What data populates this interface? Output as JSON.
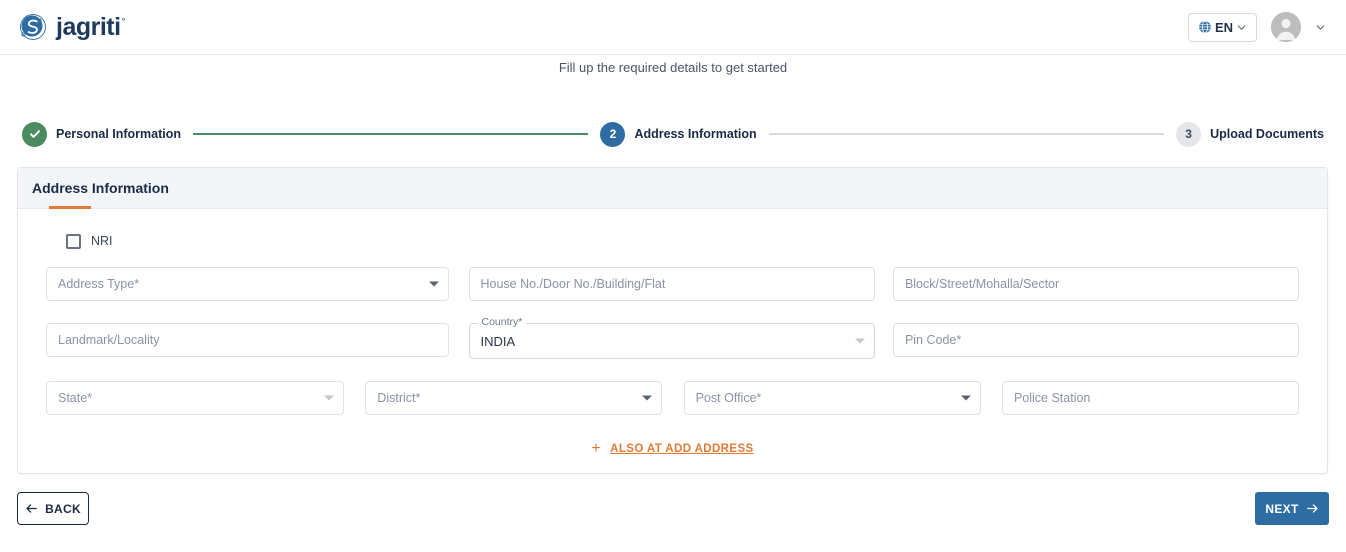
{
  "header": {
    "brand_name": "jagriti",
    "brand_sup": "°",
    "logo_icon": "jagriti-circular-s-network-logo",
    "language": {
      "label": "EN",
      "globe_icon": "globe-icon",
      "chevron_icon": "chevron-down-icon"
    },
    "account": {
      "avatar_icon": "user-avatar-icon",
      "chevron_icon": "chevron-down-icon"
    }
  },
  "subtitle": "Fill up the required details to get started",
  "stepper": {
    "steps": [
      {
        "number": "1",
        "label": "Personal Information",
        "state": "done",
        "icon": "check-icon"
      },
      {
        "number": "2",
        "label": "Address Information",
        "state": "active",
        "icon": ""
      },
      {
        "number": "3",
        "label": "Upload Documents",
        "state": "todo",
        "icon": ""
      }
    ]
  },
  "card": {
    "title": "Address Information",
    "checkbox": {
      "label": "NRI",
      "checked": false
    },
    "fields": {
      "address_type": {
        "placeholder": "Address Type*",
        "value": "",
        "type": "select"
      },
      "house_no": {
        "placeholder": "House No./Door No./Building/Flat",
        "value": "",
        "type": "text"
      },
      "block_street": {
        "placeholder": "Block/Street/Mohalla/Sector",
        "value": "",
        "type": "text"
      },
      "landmark": {
        "placeholder": "Landmark/Locality",
        "value": "",
        "type": "text"
      },
      "country": {
        "label": "Country*",
        "value": "INDIA",
        "type": "select"
      },
      "pin_code": {
        "placeholder": "Pin Code*",
        "value": "",
        "type": "text"
      },
      "state": {
        "placeholder": "State*",
        "value": "",
        "type": "select"
      },
      "district": {
        "placeholder": "District*",
        "value": "",
        "type": "select"
      },
      "post_office": {
        "placeholder": "Post Office*",
        "value": "",
        "type": "select"
      },
      "police_station": {
        "placeholder": "Police Station",
        "value": "",
        "type": "text"
      }
    },
    "add_address_link": {
      "label": "ALSO AT ADD ADDRESS",
      "icon": "plus-icon"
    }
  },
  "footer": {
    "back_label": "BACK",
    "back_icon": "arrow-left-icon",
    "next_label": "NEXT",
    "next_icon": "arrow-right-icon"
  },
  "colors": {
    "primary_blue": "#2e6da4",
    "success_green": "#4a8c5f",
    "accent_orange": "#e07b39",
    "navy_text": "#1a2b47"
  }
}
